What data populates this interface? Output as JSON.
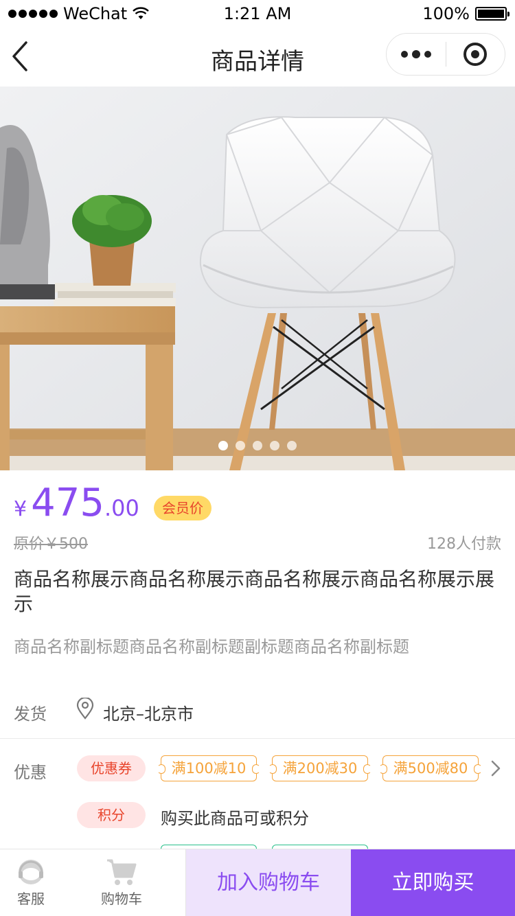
{
  "status_bar": {
    "carrier": "WeChat",
    "time": "1:21 AM",
    "battery": "100%"
  },
  "nav": {
    "title": "商品详情"
  },
  "gallery": {
    "image_count": 5,
    "active_index": 0
  },
  "price": {
    "currency": "¥",
    "integer": "475",
    "decimal": ".00",
    "member_badge": "会员价",
    "original": "原价￥500",
    "paid_count": "128人付款"
  },
  "product": {
    "name": "商品名称展示商品名称展示商品名称展示商品名称展示展示",
    "subtitle": "商品名称副标题商品名称副标题副标题商品名称副标题"
  },
  "shipping": {
    "label": "发货",
    "location": "北京–北京市"
  },
  "promotions": {
    "label": "优惠",
    "coupon_tag": "优惠券",
    "coupons": [
      "满100减10",
      "满200减30",
      "满500减80"
    ],
    "points_tag": "积分",
    "points_text": "购买此商品可或积分"
  },
  "bottom_bar": {
    "service": "客服",
    "cart": "购物车",
    "add_to_cart": "加入购物车",
    "buy_now": "立即购买"
  },
  "colors": {
    "accent": "#8a4cf0",
    "accent_light": "#eee3fc",
    "badge_bg": "#ffd966",
    "coupon": "#f5a33a",
    "tag_red": "#e8452c"
  }
}
